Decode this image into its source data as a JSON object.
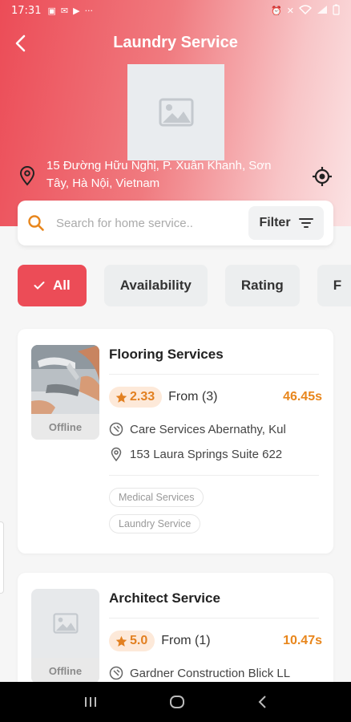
{
  "status_bar": {
    "time": "17:31"
  },
  "header": {
    "title": "Laundry Service",
    "address": "15 Đường Hữu Nghị, P. Xuân Khanh, Sơn Tây, Hà Nội, Vietnam"
  },
  "search": {
    "placeholder": "Search for home service..",
    "filter_label": "Filter"
  },
  "chips": [
    {
      "label": "All",
      "active": true
    },
    {
      "label": "Availability",
      "active": false
    },
    {
      "label": "Rating",
      "active": false
    },
    {
      "label": "F",
      "active": false
    }
  ],
  "services": [
    {
      "title": "Flooring Services",
      "rating": "2.33",
      "from": "From (3)",
      "price": "46.45s",
      "provider": "Care Services Abernathy, Kul",
      "address": "153 Laura Springs Suite 622",
      "status": "Offline",
      "tags": [
        "Medical Services",
        "Laundry Service"
      ]
    },
    {
      "title": "Architect Service",
      "rating": "5.0",
      "from": "From (1)",
      "price": "10.47s",
      "provider": "Gardner Construction Blick LL",
      "status": "Offline"
    }
  ],
  "colors": {
    "accent": "#ec4c57",
    "rating": "#e28021",
    "price": "#e8861c"
  },
  "icons": [
    "back-arrow-icon",
    "image-placeholder-icon",
    "location-pin-icon",
    "my-location-icon",
    "search-icon",
    "filter-icon",
    "check-icon",
    "star-icon",
    "provider-icon"
  ]
}
